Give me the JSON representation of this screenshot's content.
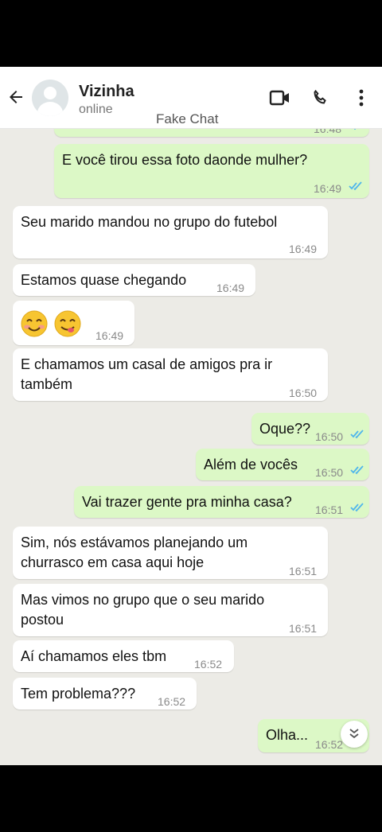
{
  "header": {
    "contact_name": "Vizinha",
    "status": "online",
    "watermark": "Fake Chat"
  },
  "colors": {
    "incoming_bubble": "#ffffff",
    "outgoing_bubble": "#dcf8c6",
    "read_tick": "#4fb6ec",
    "chat_background": "#ecebe6"
  },
  "icons": [
    "back-arrow-icon",
    "avatar-icon",
    "video-call-icon",
    "phone-icon",
    "more-options-icon",
    "double-check-icon",
    "scroll-down-icon"
  ],
  "messages": [
    {
      "side": "out",
      "text": "",
      "time": "16:48",
      "read": true
    },
    {
      "side": "out",
      "text": "E você tirou essa foto daonde mulher?",
      "time": "16:49",
      "read": true
    },
    {
      "side": "in",
      "text": "Seu marido mandou no grupo do futebol",
      "time": "16:49"
    },
    {
      "side": "in",
      "text": "Estamos quase chegando",
      "time": "16:49"
    },
    {
      "side": "in",
      "text": "😊😋",
      "time": "16:49"
    },
    {
      "side": "in",
      "line1": "E chamamos um casal de amigos pra ir",
      "line2": "também",
      "time": "16:50"
    },
    {
      "side": "out",
      "text": "Oque??",
      "time": "16:50",
      "read": true
    },
    {
      "side": "out",
      "text": "Além de vocês",
      "time": "16:50",
      "read": true
    },
    {
      "side": "out",
      "text": "Vai trazer gente pra minha casa?",
      "time": "16:51",
      "read": true
    },
    {
      "side": "in",
      "line1": "Sim, nós estávamos planejando um",
      "line2": "churrasco em casa aqui hoje",
      "time": "16:51"
    },
    {
      "side": "in",
      "line1": "Mas vimos no grupo que o seu marido",
      "line2": "postou",
      "time": "16:51"
    },
    {
      "side": "in",
      "text": "Aí chamamos eles tbm",
      "time": "16:52"
    },
    {
      "side": "in",
      "text": "Tem problema???",
      "time": "16:52"
    },
    {
      "side": "out",
      "text": "Olha...",
      "time": "16:52",
      "read": true
    }
  ]
}
